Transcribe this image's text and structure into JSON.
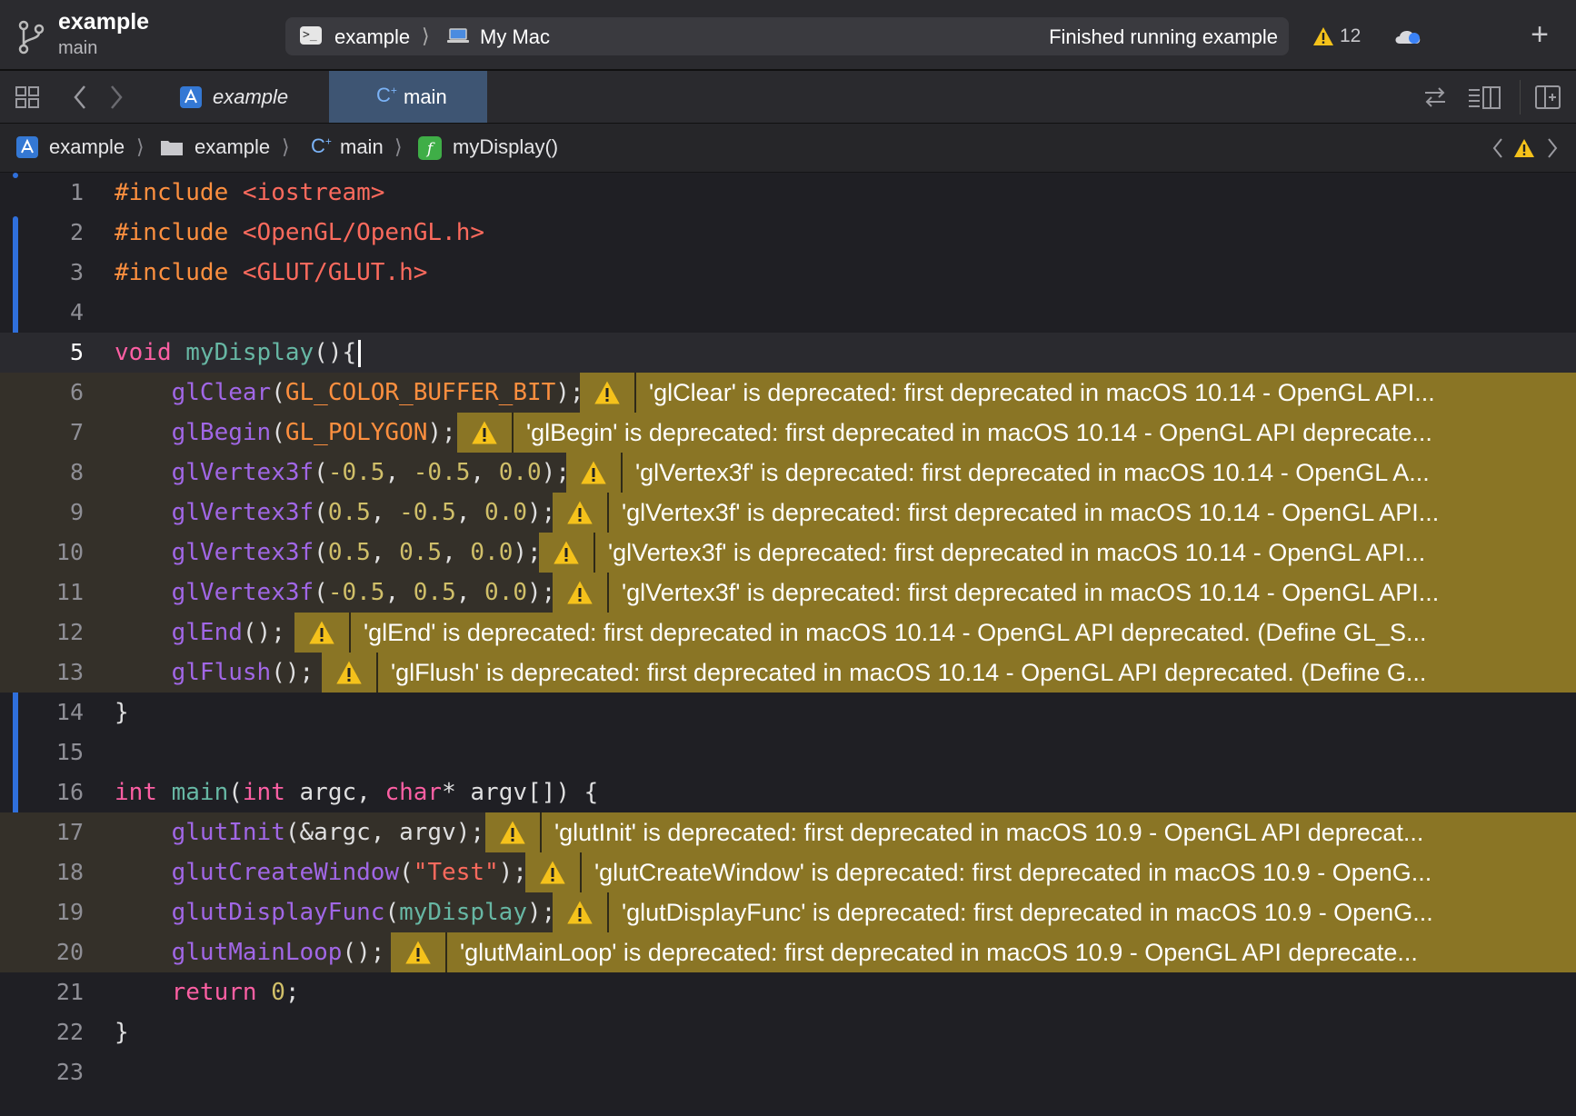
{
  "toolbar": {
    "project_name": "example",
    "branch": "main",
    "scheme": "example",
    "scheme_sep": "⟩",
    "destination": "My Mac",
    "status": "Finished running example",
    "warning_count": "12",
    "add_label": "+"
  },
  "tabs": [
    {
      "label": "example"
    },
    {
      "label": "main"
    }
  ],
  "jumpbar": {
    "items": [
      "example",
      "example",
      "main",
      "myDisplay()"
    ],
    "sep": "⟩"
  },
  "editor": {
    "lines": [
      {
        "n": "1"
      },
      {
        "n": "2"
      },
      {
        "n": "3"
      },
      {
        "n": "4"
      },
      {
        "n": "5"
      },
      {
        "n": "6",
        "warning": "'glClear' is deprecated: first deprecated in macOS 10.14 - OpenGL API..."
      },
      {
        "n": "7",
        "warning": "'glBegin' is deprecated: first deprecated in macOS 10.14 - OpenGL API deprecate..."
      },
      {
        "n": "8",
        "warning": "'glVertex3f' is deprecated: first deprecated in macOS 10.14 - OpenGL A..."
      },
      {
        "n": "9",
        "warning": "'glVertex3f' is deprecated: first deprecated in macOS 10.14 - OpenGL API..."
      },
      {
        "n": "10",
        "warning": "'glVertex3f' is deprecated: first deprecated in macOS 10.14 - OpenGL API..."
      },
      {
        "n": "11",
        "warning": "'glVertex3f' is deprecated: first deprecated in macOS 10.14 - OpenGL API..."
      },
      {
        "n": "12",
        "warning": "'glEnd' is deprecated: first deprecated in macOS 10.14 - OpenGL API deprecated. (Define GL_S..."
      },
      {
        "n": "13",
        "warning": "'glFlush' is deprecated: first deprecated in macOS 10.14 - OpenGL API deprecated. (Define G..."
      },
      {
        "n": "14"
      },
      {
        "n": "15"
      },
      {
        "n": "16"
      },
      {
        "n": "17",
        "warning": "'glutInit' is deprecated: first deprecated in macOS 10.9 - OpenGL API deprecat..."
      },
      {
        "n": "18",
        "warning": "'glutCreateWindow' is deprecated: first deprecated in macOS 10.9 - OpenG..."
      },
      {
        "n": "19",
        "warning": "'glutDisplayFunc' is deprecated: first deprecated in macOS 10.9 - OpenG..."
      },
      {
        "n": "20",
        "warning": "'glutMainLoop' is deprecated: first deprecated in macOS 10.9 - OpenGL API deprecate..."
      },
      {
        "n": "21"
      },
      {
        "n": "22"
      },
      {
        "n": "23"
      }
    ],
    "tokens": {
      "include": "#include",
      "iostream": "<iostream>",
      "opengl_h": "<OpenGL/OpenGL.h>",
      "glut_h": "<GLUT/GLUT.h>",
      "void": "void",
      "myDisplay": "myDisplay",
      "glClear": "glClear",
      "GL_COLOR_BUFFER_BIT": "GL_COLOR_BUFFER_BIT",
      "glBegin": "glBegin",
      "GL_POLYGON": "GL_POLYGON",
      "glVertex3f": "glVertex3f",
      "n_m05": "-0.5",
      "n_05": "0.5",
      "n_00": "0.0",
      "glEnd": "glEnd",
      "glFlush": "glFlush",
      "int": "int",
      "main": "main",
      "argc": "argc",
      "char": "char",
      "argv": "argv",
      "glutInit": "glutInit",
      "glutCreateWindow": "glutCreateWindow",
      "test_str": "\"Test\"",
      "glutDisplayFunc": "glutDisplayFunc",
      "glutMainLoop": "glutMainLoop",
      "return": "return",
      "zero": "0"
    }
  },
  "colors": {
    "keyword": "#fc5fa3",
    "preprocessor": "#fd8f3f",
    "function": "#67b7a4",
    "number": "#d0bf69",
    "string": "#fc6a5d",
    "warning_banner": "#8a7525",
    "change_bar": "#2f6fdb",
    "active_tab": "#3e5573"
  }
}
